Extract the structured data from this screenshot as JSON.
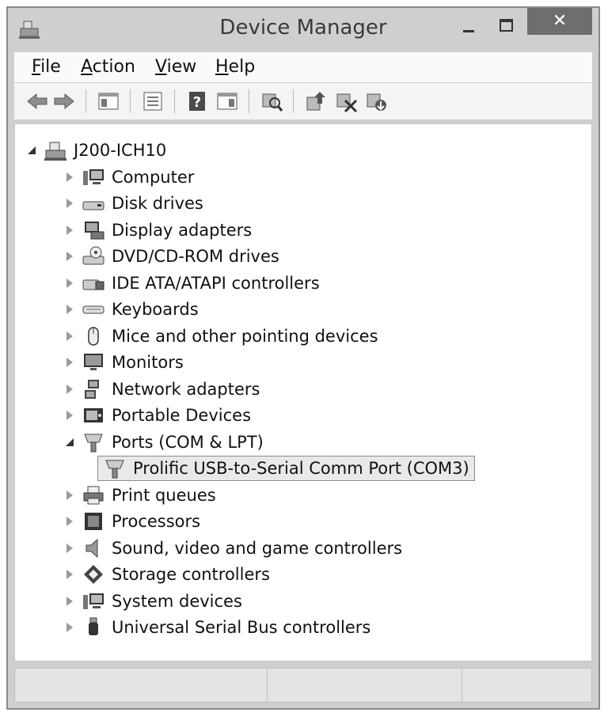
{
  "window": {
    "title": "Device Manager",
    "close_glyph": "✕",
    "min_glyph": "–",
    "max_glyph": "☐"
  },
  "menu": [
    {
      "label_u": "F",
      "label_rest": "ile"
    },
    {
      "label_u": "A",
      "label_rest": "ction"
    },
    {
      "label_u": "V",
      "label_rest": "iew"
    },
    {
      "label_u": "H",
      "label_rest": "elp"
    }
  ],
  "toolbar": [
    "back-icon",
    "forward-icon",
    "show-hide-console-tree-icon",
    "properties-icon",
    "help-icon",
    "show-action-pane-icon",
    "scan-hardware-icon",
    "update-driver-icon",
    "disable-device-icon",
    "uninstall-device-icon"
  ],
  "tree": {
    "root": {
      "label": "J200-ICH10",
      "icon": "computer-root-icon"
    },
    "items": [
      {
        "label": "Computer",
        "icon": "computer-icon",
        "state": "collapsed"
      },
      {
        "label": "Disk drives",
        "icon": "disk-drive-icon",
        "state": "collapsed"
      },
      {
        "label": "Display adapters",
        "icon": "display-adapter-icon",
        "state": "collapsed"
      },
      {
        "label": "DVD/CD-ROM drives",
        "icon": "dvd-drive-icon",
        "state": "collapsed"
      },
      {
        "label": "IDE ATA/ATAPI controllers",
        "icon": "ide-controller-icon",
        "state": "collapsed"
      },
      {
        "label": "Keyboards",
        "icon": "keyboard-icon",
        "state": "collapsed"
      },
      {
        "label": "Mice and other pointing devices",
        "icon": "mouse-icon",
        "state": "collapsed"
      },
      {
        "label": "Monitors",
        "icon": "monitor-icon",
        "state": "collapsed"
      },
      {
        "label": "Network adapters",
        "icon": "network-adapter-icon",
        "state": "collapsed"
      },
      {
        "label": "Portable Devices",
        "icon": "portable-device-icon",
        "state": "collapsed"
      },
      {
        "label": "Ports (COM & LPT)",
        "icon": "port-icon",
        "state": "expanded"
      },
      {
        "label": "Prolific USB-to-Serial Comm Port (COM3)",
        "icon": "serial-port-icon",
        "state": "child-selected"
      },
      {
        "label": "Print queues",
        "icon": "printer-icon",
        "state": "collapsed"
      },
      {
        "label": "Processors",
        "icon": "processor-icon",
        "state": "collapsed"
      },
      {
        "label": "Sound, video and game controllers",
        "icon": "speaker-icon",
        "state": "collapsed"
      },
      {
        "label": "Storage controllers",
        "icon": "storage-controller-icon",
        "state": "collapsed"
      },
      {
        "label": "System devices",
        "icon": "system-device-icon",
        "state": "collapsed"
      },
      {
        "label": "Universal Serial Bus controllers",
        "icon": "usb-icon",
        "state": "collapsed"
      }
    ]
  }
}
